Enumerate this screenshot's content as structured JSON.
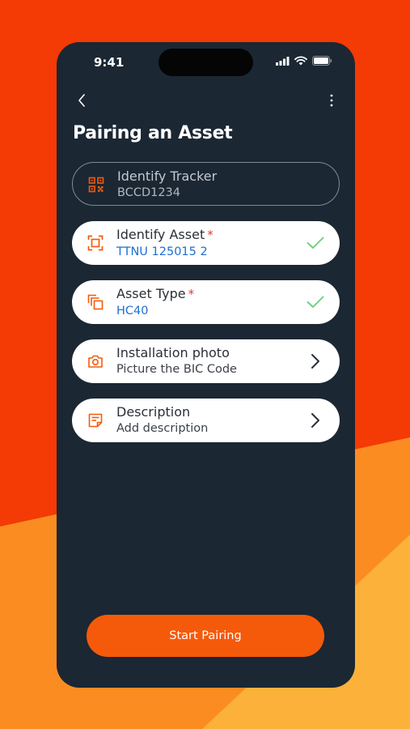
{
  "status": {
    "time": "9:41"
  },
  "header": {
    "title": "Pairing an Asset"
  },
  "cards": [
    {
      "title": "Identify Tracker",
      "subtitle": "BCCD1234",
      "icon": "qr-code-icon",
      "required": false,
      "state": "disabled"
    },
    {
      "title": "Identify Asset",
      "subtitle": "TTNU 125015 2",
      "icon": "scan-frame-icon",
      "required": true,
      "required_mark": "*",
      "state": "completed"
    },
    {
      "title": "Asset Type",
      "subtitle": "HC40",
      "icon": "layers-icon",
      "required": true,
      "required_mark": "*",
      "state": "completed"
    },
    {
      "title": "Installation photo",
      "subtitle": "Picture the BIC Code",
      "icon": "camera-icon",
      "required": false,
      "state": "navigate"
    },
    {
      "title": "Description",
      "subtitle": "Add description",
      "icon": "note-icon",
      "required": false,
      "state": "navigate"
    }
  ],
  "footer": {
    "primary_label": "Start Pairing"
  },
  "colors": {
    "background_orange": "#f43a05",
    "background_amber": "#fba52a",
    "phone_bg": "#1b2733",
    "accent": "#f55a0a",
    "value_blue": "#1f6fd1",
    "check_green": "#6bcf7f",
    "required_red": "#e53935"
  }
}
